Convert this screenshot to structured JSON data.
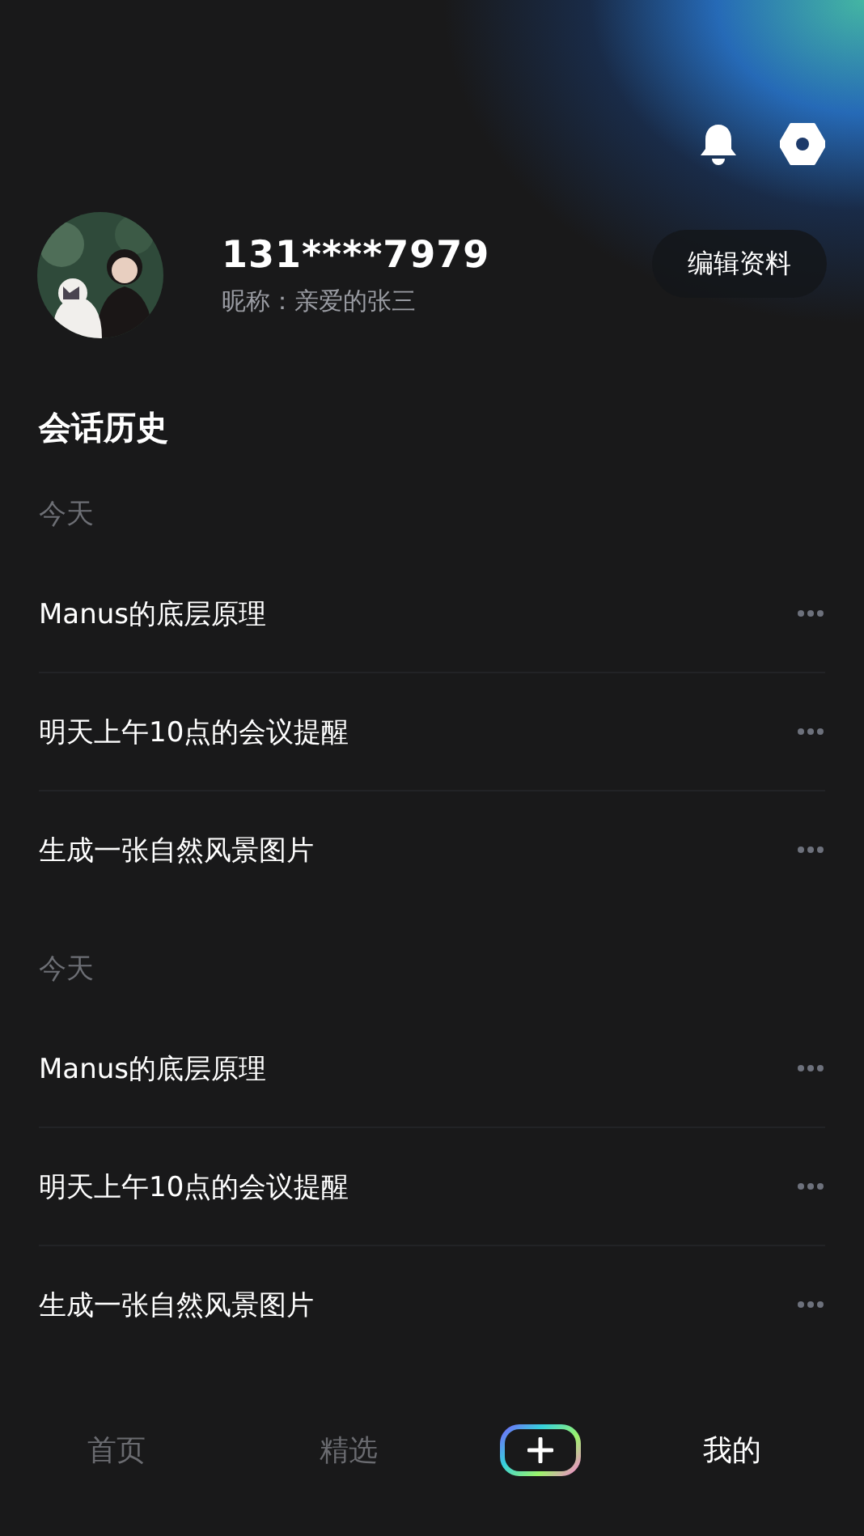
{
  "profile": {
    "phone": "131****7979",
    "nickname": "昵称：亲爱的张三",
    "edit_button": "编辑资料"
  },
  "history": {
    "title": "会话历史",
    "groups": [
      {
        "label": "今天",
        "items": [
          "Manus的底层原理",
          "明天上午10点的会议提醒",
          "生成一张自然风景图片"
        ]
      },
      {
        "label": "今天",
        "items": [
          "Manus的底层原理",
          "明天上午10点的会议提醒",
          "生成一张自然风景图片"
        ]
      }
    ]
  },
  "tab_bar": [
    {
      "kind": "tab",
      "label": "首页",
      "selected": false
    },
    {
      "kind": "tab",
      "label": "精选",
      "selected": false
    },
    {
      "kind": "add"
    },
    {
      "kind": "tab",
      "label": "我的",
      "selected": true
    }
  ]
}
